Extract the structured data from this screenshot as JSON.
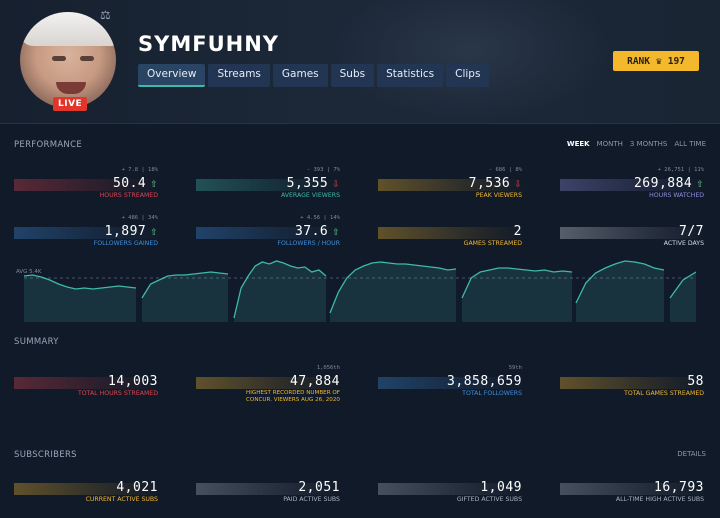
{
  "header": {
    "channel_name": "SYMFUHNY",
    "live_label": "LIVE",
    "rank_label": "RANK",
    "rank_value": "197",
    "tabs": [
      {
        "label": "Overview",
        "active": true
      },
      {
        "label": "Streams",
        "active": false
      },
      {
        "label": "Games",
        "active": false
      },
      {
        "label": "Subs",
        "active": false
      },
      {
        "label": "Statistics",
        "active": false
      },
      {
        "label": "Clips",
        "active": false
      }
    ]
  },
  "performance": {
    "title": "PERFORMANCE",
    "filters": [
      {
        "label": "WEEK",
        "active": true
      },
      {
        "label": "MONTH",
        "active": false
      },
      {
        "label": "3 MONTHS",
        "active": false
      },
      {
        "label": "ALL TIME",
        "active": false
      }
    ],
    "cards": [
      {
        "sub": "+ 7.8 | 18%",
        "value": "50.4",
        "trend": "up",
        "label": "HOURS STREAMED",
        "color": "#e0434d"
      },
      {
        "sub": "- 393 | 7%",
        "value": "5,355",
        "trend": "down",
        "label": "AVERAGE VIEWERS",
        "color": "#3fb9a8"
      },
      {
        "sub": "- 686 | 8%",
        "value": "7,536",
        "trend": "down",
        "label": "PEAK VIEWERS",
        "color": "#f4b82c"
      },
      {
        "sub": "+ 26,751 | 11%",
        "value": "269,884",
        "trend": "up",
        "label": "HOURS WATCHED",
        "color": "#8c8fe0"
      },
      {
        "sub": "+ 486 | 34%",
        "value": "1,897",
        "trend": "up",
        "label": "FOLLOWERS GAINED",
        "color": "#3d8fe0"
      },
      {
        "sub": "+ 4.56 | 14%",
        "value": "37.6",
        "trend": "up",
        "label": "FOLLOWERS / HOUR",
        "color": "#3d8fe0"
      },
      {
        "sub": "",
        "value": "2",
        "trend": "",
        "label": "GAMES STREAMED",
        "color": "#f4b82c"
      },
      {
        "sub": "",
        "value": "7/7",
        "trend": "",
        "label": "ACTIVE DAYS",
        "color": "#d7dde6"
      }
    ],
    "avg_label": "AVG 5.4K"
  },
  "summary": {
    "title": "SUMMARY",
    "cards": [
      {
        "sub": "",
        "value": "14,003",
        "label": "TOTAL HOURS STREAMED",
        "color": "#e0434d"
      },
      {
        "sub": "1,056th",
        "value": "47,884",
        "label": "HIGHEST RECORDED NUMBER OF CONCUR. VIEWERS AUG 26, 2020",
        "color": "#f4b82c"
      },
      {
        "sub": "59th",
        "value": "3,858,659",
        "label": "TOTAL FOLLOWERS",
        "color": "#3d8fe0"
      },
      {
        "sub": "",
        "value": "58",
        "label": "TOTAL GAMES STREAMED",
        "color": "#f4b82c"
      }
    ]
  },
  "subscribers": {
    "title": "SUBSCRIBERS",
    "details_label": "DETAILS",
    "cards": [
      {
        "value": "4,021",
        "label": "CURRENT ACTIVE SUBS",
        "color": "#f4b82c"
      },
      {
        "value": "2,051",
        "label": "PAID ACTIVE SUBS",
        "color": "#aab3c0"
      },
      {
        "value": "1,049",
        "label": "GIFTED ACTIVE SUBS",
        "color": "#aab3c0"
      },
      {
        "value": "16,793",
        "label": "ALL-TIME HIGH ACTIVE SUBS",
        "color": "#aab3c0"
      }
    ]
  },
  "colors": {
    "accent": "#3fb9a8",
    "rank_badge": "#f4b82c",
    "live": "#e2362b",
    "background": "#111a29"
  }
}
